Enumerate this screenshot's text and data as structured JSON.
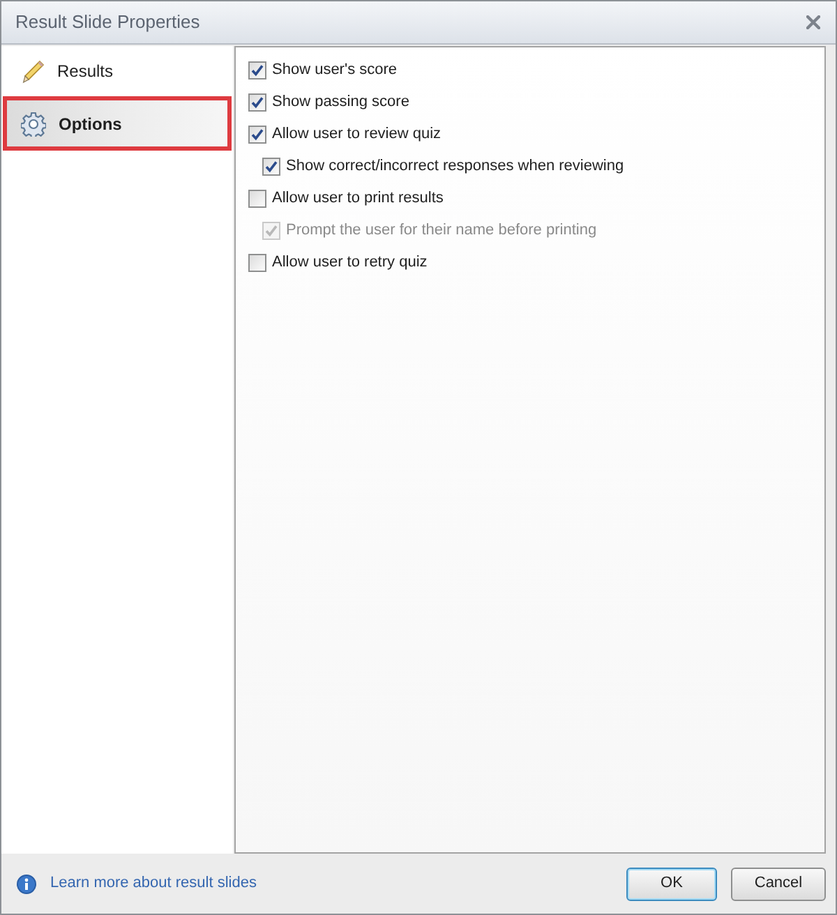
{
  "window": {
    "title": "Result Slide Properties"
  },
  "sidebar": {
    "items": [
      {
        "label": "Results",
        "selected": false,
        "highlighted": false
      },
      {
        "label": "Options",
        "selected": true,
        "highlighted": true
      }
    ]
  },
  "options": [
    {
      "label": "Show user's score",
      "checked": true,
      "disabled": false
    },
    {
      "label": "Show passing score",
      "checked": true,
      "disabled": false
    },
    {
      "label": "Allow user to review quiz",
      "checked": true,
      "disabled": false,
      "children": [
        {
          "label": "Show correct/incorrect responses when reviewing",
          "checked": true,
          "disabled": false
        }
      ]
    },
    {
      "label": "Allow user to print results",
      "checked": false,
      "disabled": false,
      "children": [
        {
          "label": "Prompt the user for their name before printing",
          "checked": true,
          "disabled": true
        }
      ]
    },
    {
      "label": "Allow user to retry quiz",
      "checked": false,
      "disabled": false
    }
  ],
  "footer": {
    "help_link": "Learn more about result slides",
    "buttons": [
      {
        "label": "OK",
        "default": true
      },
      {
        "label": "Cancel",
        "default": false
      }
    ]
  }
}
